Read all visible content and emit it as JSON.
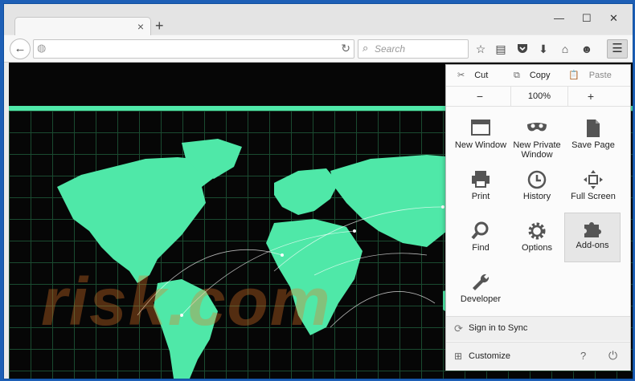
{
  "tab": {
    "close": "×",
    "new": "+"
  },
  "window_controls": {
    "minimize": "—",
    "maximize": "☐",
    "close": "✕"
  },
  "navbar": {
    "back": "←",
    "url_value": "",
    "reload": "↻",
    "search_placeholder": "Search",
    "icons": [
      "star-icon",
      "reading-list-icon",
      "pocket-icon",
      "download-icon",
      "home-icon",
      "hello-icon"
    ],
    "menu": "☰"
  },
  "watermark": "risk.com",
  "menu": {
    "edit": {
      "cut": "Cut",
      "copy": "Copy",
      "paste": "Paste"
    },
    "zoom": {
      "minus": "−",
      "value": "100%",
      "plus": "+"
    },
    "items": [
      {
        "label": "New Window",
        "icon": "new-window-icon"
      },
      {
        "label": "New Private Window",
        "icon": "private-mask-icon"
      },
      {
        "label": "Save Page",
        "icon": "save-page-icon"
      },
      {
        "label": "Print",
        "icon": "printer-icon"
      },
      {
        "label": "History",
        "icon": "history-clock-icon"
      },
      {
        "label": "Full Screen",
        "icon": "fullscreen-icon"
      },
      {
        "label": "Find",
        "icon": "find-magnifier-icon"
      },
      {
        "label": "Options",
        "icon": "gear-icon"
      },
      {
        "label": "Add-ons",
        "icon": "puzzle-icon"
      },
      {
        "label": "Developer",
        "icon": "wrench-icon"
      }
    ],
    "sync": "Sign in to Sync",
    "customize": "Customize",
    "help": "?",
    "power": "⏻"
  },
  "colors": {
    "accent_teal": "#4fe8a8",
    "frame_blue": "#1d5fb6"
  }
}
